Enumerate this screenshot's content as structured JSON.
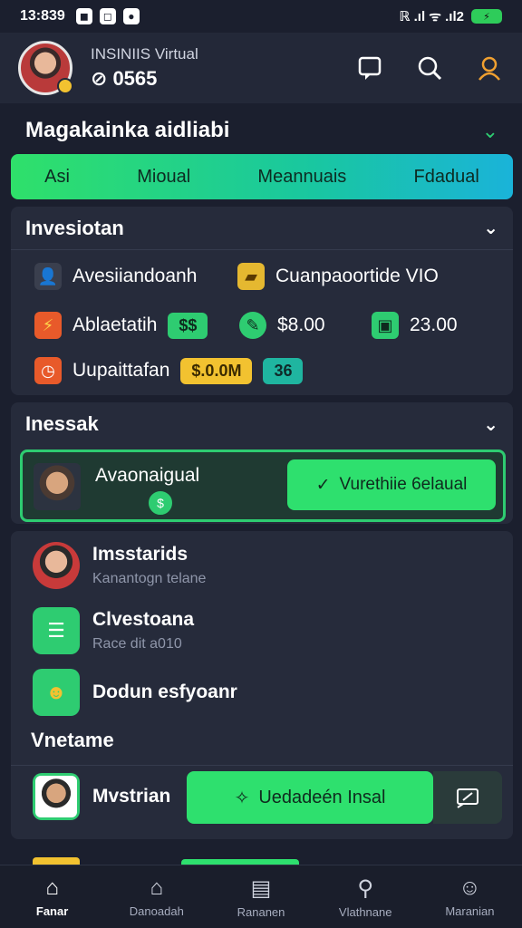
{
  "status": {
    "time": "13:839",
    "network": "ℝ .ıl ᯤ .ıl2"
  },
  "header": {
    "user_name": "INSINIIS Virtual",
    "balance": "0565",
    "avatar": "user-avatar",
    "actions": [
      "chat-icon",
      "search-icon",
      "profile-icon"
    ]
  },
  "page_title": "Magakainka aidliabi",
  "tabs": [
    "Asi",
    "Mioual",
    "Meannuais",
    "Fdadual"
  ],
  "investment": {
    "title": "Invesiotan",
    "rows": [
      {
        "label": "Avesiiandoanh",
        "icon": "person-icon"
      },
      {
        "label": "Cuanpaoortide VIO",
        "icon": "ticket-icon"
      },
      {
        "label": "Ablaetatih",
        "badge": "$$",
        "icon": "lightning-icon"
      },
      {
        "value": "$8.00",
        "icon": "pen-icon"
      },
      {
        "value": "23.00",
        "icon": "monitor-icon"
      },
      {
        "label": "Uupaittafan",
        "amount": "$.0.0M",
        "count": "36",
        "icon": "clock-icon"
      }
    ]
  },
  "inessak": {
    "title": "Inessak",
    "promo": {
      "name": "Avaonaigual",
      "badge": "$",
      "button": "Vurethiie 6elaual"
    }
  },
  "list": {
    "items": [
      {
        "title": "Imsstarids",
        "subtitle": "Kanantogn telane"
      },
      {
        "title": "Clvestoana",
        "subtitle": "Race dit a010"
      },
      {
        "title": "Dodun esfyoanr",
        "subtitle": ""
      }
    ],
    "section_label": "Vnetame",
    "cta_name": "Mvstrian",
    "cta_button": "Uedadeén Insal"
  },
  "bottom_nav": [
    {
      "label": "Fanar",
      "icon": "home-icon",
      "active": true
    },
    {
      "label": "Danoadah",
      "icon": "bank-icon",
      "active": false
    },
    {
      "label": "Rananen",
      "icon": "book-icon",
      "active": false
    },
    {
      "label": "Vlathnane",
      "icon": "search-icon",
      "active": false
    },
    {
      "label": "Maranian",
      "icon": "user-icon",
      "active": false
    }
  ]
}
